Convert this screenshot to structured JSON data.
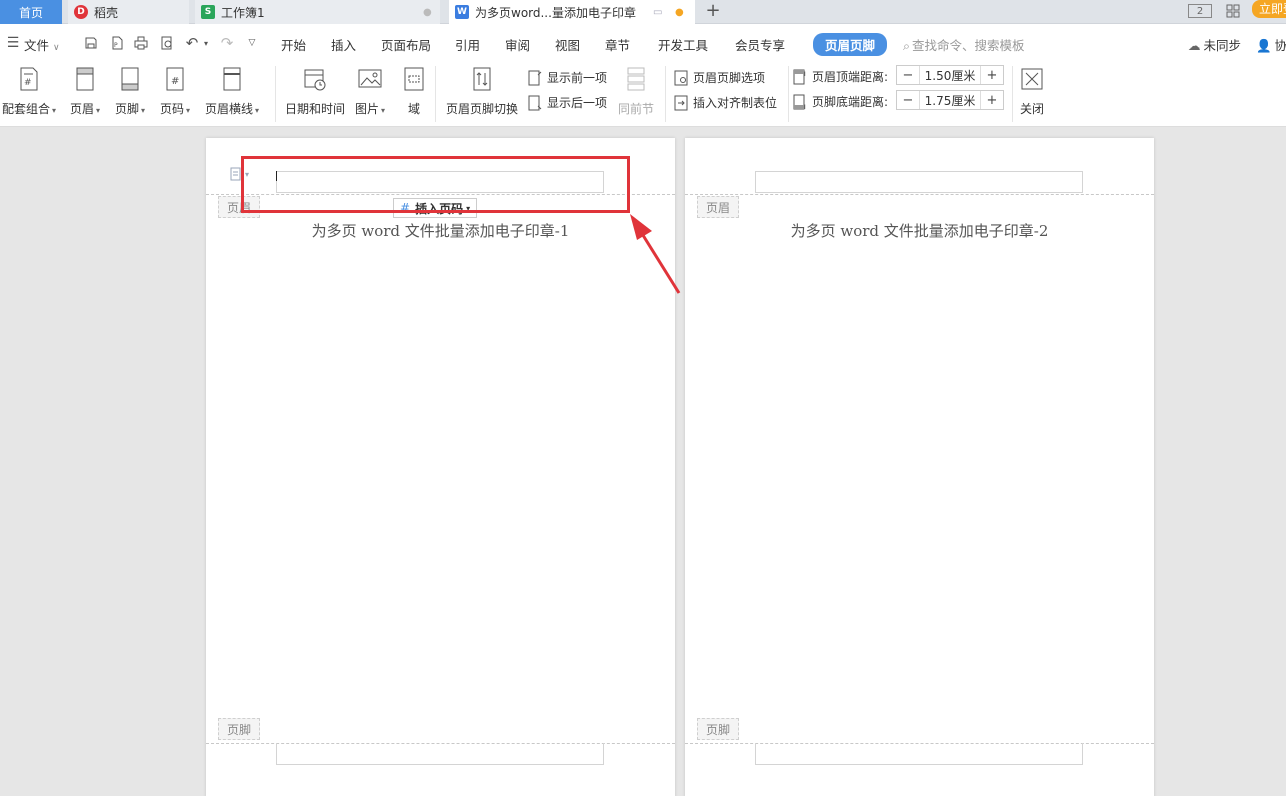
{
  "tabs": {
    "home": "首页",
    "daoke": "稻壳",
    "workbook": "工作簿1",
    "document": "为多页word...量添加电子印章"
  },
  "window": {
    "page_count_icon": "2",
    "login": "立即登录"
  },
  "menu": {
    "file": "文件",
    "items": [
      "开始",
      "插入",
      "页面布局",
      "引用",
      "审阅",
      "视图",
      "章节",
      "开发工具",
      "会员专享"
    ],
    "active": "页眉页脚",
    "search_placeholder": "查找命令、搜索模板",
    "sync": "未同步",
    "collab": "协作"
  },
  "ribbon": {
    "combo": "配套组合",
    "header": "页眉",
    "footer": "页脚",
    "page_number": "页码",
    "header_line": "页眉横线",
    "datetime": "日期和时间",
    "picture": "图片",
    "field": "域",
    "switch": "页眉页脚切换",
    "show_prev": "显示前一项",
    "show_next": "显示后一项",
    "same_as_prev": "同前节",
    "hf_options": "页眉页脚选项",
    "insert_align_tab": "插入对齐制表位",
    "header_top_label": "页眉顶端距离:",
    "header_top_value": "1.50厘米",
    "footer_bottom_label": "页脚底端距离:",
    "footer_bottom_value": "1.75厘米",
    "close": "关闭"
  },
  "pages": [
    {
      "title": "为多页 word 文件批量添加电子印章-1",
      "header_tag": "页眉",
      "footer_tag": "页脚",
      "insert_page_number": "插入页码"
    },
    {
      "title": "为多页 word 文件批量添加电子印章-2",
      "header_tag": "页眉",
      "footer_tag": "页脚"
    }
  ],
  "colors": {
    "accent": "#4a90e2",
    "highlight": "#e0343a",
    "login": "#f5a623"
  }
}
